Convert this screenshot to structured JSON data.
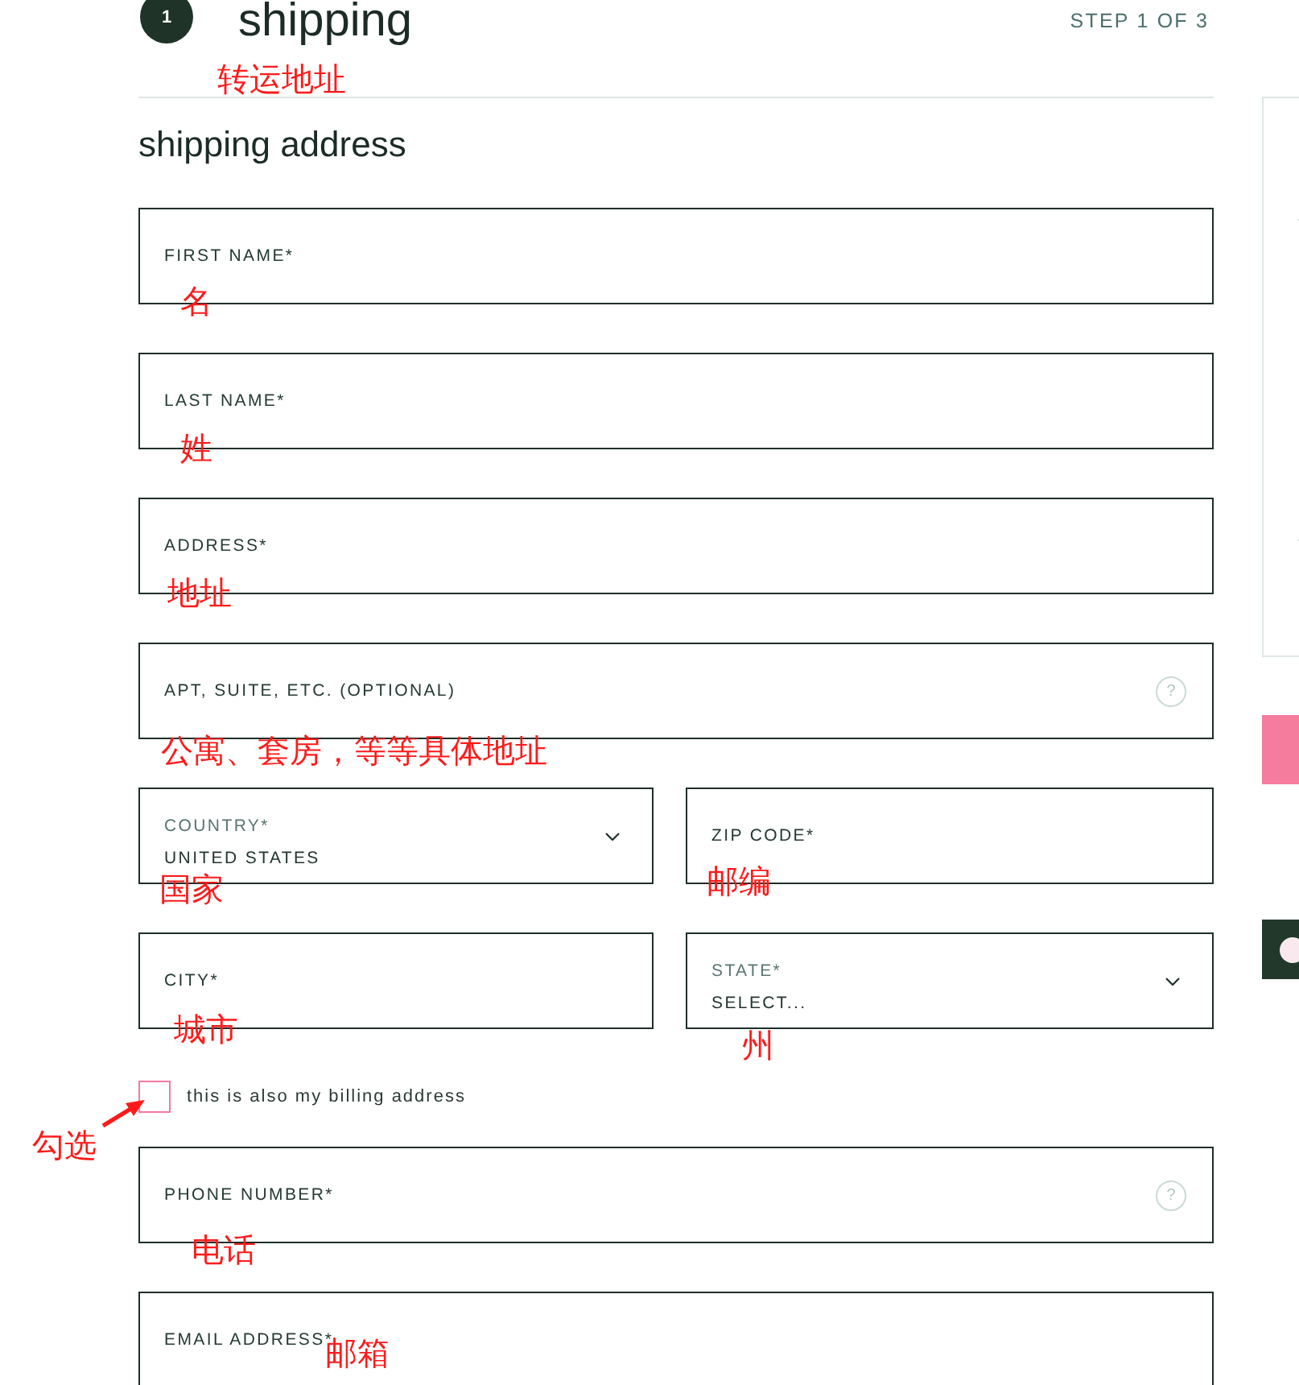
{
  "header": {
    "step_number": "1",
    "title": "shipping",
    "step_label": "STEP 1 OF 3",
    "annotation": "转运地址"
  },
  "section_title": "shipping address",
  "form": [
    {
      "kind": "row",
      "fields": [
        {
          "kind": "text",
          "label": "FIRST NAME*",
          "annotation": "名"
        }
      ]
    },
    {
      "kind": "row",
      "fields": [
        {
          "kind": "text",
          "label": "LAST NAME*",
          "annotation": "姓"
        }
      ]
    },
    {
      "kind": "row",
      "fields": [
        {
          "kind": "text",
          "label": "ADDRESS*",
          "annotation": "地址"
        }
      ]
    },
    {
      "kind": "row",
      "fields": [
        {
          "kind": "text",
          "label": "APT, SUITE, ETC. (OPTIONAL)",
          "help": "?",
          "annotation": "公寓、套房，等等具体地址"
        }
      ]
    },
    {
      "kind": "row",
      "fields": [
        {
          "kind": "select",
          "label": "COUNTRY*",
          "value": "UNITED STATES",
          "annotation": "国家"
        },
        {
          "kind": "text",
          "label": "ZIP CODE*",
          "annotation": "邮编"
        }
      ]
    },
    {
      "kind": "row",
      "fields": [
        {
          "kind": "text",
          "label": "CITY*",
          "annotation": "城市"
        },
        {
          "kind": "select",
          "label": "STATE*",
          "placeholder": "SELECT...",
          "annotation": "州"
        }
      ]
    },
    {
      "kind": "checkbox",
      "label": "this is also my billing address",
      "checked": false,
      "annotation": "勾选"
    },
    {
      "kind": "row",
      "fields": [
        {
          "kind": "text",
          "label": "PHONE NUMBER*",
          "help": "?",
          "annotation": "电话"
        }
      ]
    },
    {
      "kind": "row",
      "fields": [
        {
          "kind": "text",
          "label": "EMAIL ADDRESS*",
          "annotation": "邮箱"
        }
      ]
    }
  ]
}
